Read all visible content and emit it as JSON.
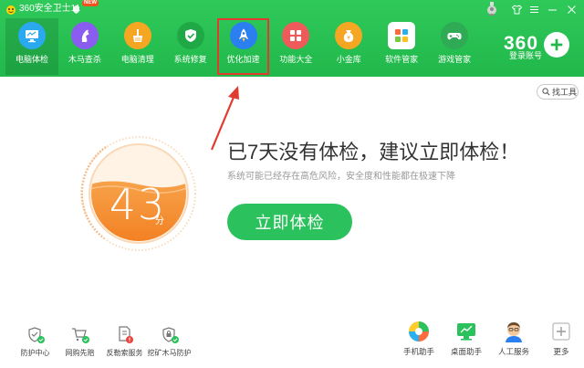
{
  "app": {
    "title": "360安全卫士11",
    "new_badge": "NEW"
  },
  "nav": {
    "items": [
      {
        "label": "电脑体检",
        "icon": "monitor-icon",
        "color": "#2aa9f0",
        "active": true
      },
      {
        "label": "木马查杀",
        "icon": "horse-icon",
        "color": "#8a5cf0"
      },
      {
        "label": "电脑清理",
        "icon": "broom-icon",
        "color": "#f5a623"
      },
      {
        "label": "系统修复",
        "icon": "shield-check-icon",
        "color": "#22b84b"
      },
      {
        "label": "优化加速",
        "icon": "rocket-icon",
        "color": "#2b7ff0"
      },
      {
        "label": "功能大全",
        "icon": "grid-icon",
        "color": "#ef5a5a"
      },
      {
        "label": "小金库",
        "icon": "coin-bag-icon",
        "color": "#f5a623"
      },
      {
        "label": "软件管家",
        "icon": "apps-icon",
        "color": "#ff8a3d"
      },
      {
        "label": "游戏管家",
        "icon": "gamepad-icon",
        "color": "#2faa55"
      }
    ]
  },
  "brand": {
    "text": "360",
    "login_label": "登录账号"
  },
  "tools": {
    "find_label": "找工具"
  },
  "status": {
    "score": "43",
    "score_unit": "分",
    "headline": "已7天没有体检，建议立即体检！",
    "subline": "系统可能已经存在高危风险，安全度和性能都在极速下降",
    "check_button": "立即体检",
    "gauge_fill_percent": 43
  },
  "footer_left": [
    {
      "label": "防护中心",
      "icon": "shield-protect-icon"
    },
    {
      "label": "网购先赔",
      "icon": "cart-check-icon"
    },
    {
      "label": "反勒索服务",
      "icon": "doc-shield-icon"
    },
    {
      "label": "挖矿木马防护",
      "icon": "lock-shield-icon"
    }
  ],
  "footer_right": [
    {
      "label": "手机助手",
      "icon": "phone-assistant-icon"
    },
    {
      "label": "桌面助手",
      "icon": "desktop-assistant-icon"
    },
    {
      "label": "人工服务",
      "icon": "human-service-icon"
    },
    {
      "label": "更多",
      "icon": "more-icon"
    }
  ],
  "colors": {
    "header_green": "#22b84b",
    "primary_button": "#2bc15c",
    "gauge_orange": "#f58a2a",
    "highlight_red": "#e13b30"
  }
}
